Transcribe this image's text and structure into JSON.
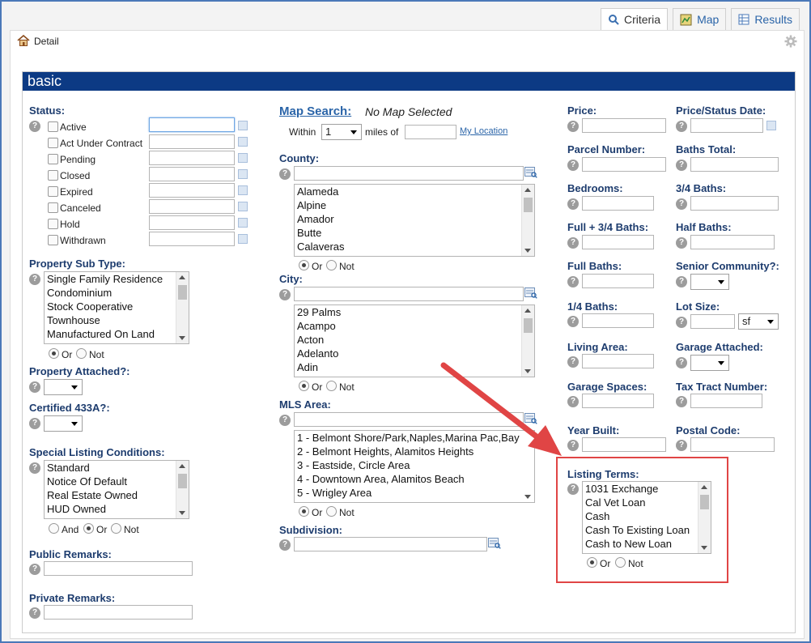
{
  "tabs": [
    {
      "label": "Criteria",
      "icon": "search-icon"
    },
    {
      "label": "Map",
      "icon": "map-icon"
    },
    {
      "label": "Results",
      "icon": "results-table-icon"
    }
  ],
  "detail": {
    "label": "Detail",
    "icon": "home-icon"
  },
  "section_title": "basic",
  "status": {
    "label": "Status:",
    "items": [
      "Active",
      "Act Under Contract",
      "Pending",
      "Closed",
      "Expired",
      "Canceled",
      "Hold",
      "Withdrawn"
    ]
  },
  "property_sub_type": {
    "label": "Property Sub Type:",
    "options": [
      "Single Family Residence",
      "Condominium",
      "Stock Cooperative",
      "Townhouse",
      "Manufactured On Land"
    ],
    "or": "Or",
    "not": "Not"
  },
  "property_attached": {
    "label": "Property Attached?:"
  },
  "certified_433a": {
    "label": "Certified 433A?:"
  },
  "special_listing": {
    "label": "Special Listing Conditions:",
    "options": [
      "Standard",
      "Notice Of Default",
      "Real Estate Owned",
      "HUD Owned"
    ],
    "and": "And",
    "or": "Or",
    "not": "Not"
  },
  "public_remarks": {
    "label": "Public Remarks:"
  },
  "private_remarks": {
    "label": "Private Remarks:"
  },
  "map_search": {
    "link": "Map Search:",
    "status": "No Map Selected",
    "within": "Within",
    "within_value": "1",
    "miles_of": "miles of",
    "my_location": "My Location"
  },
  "county": {
    "label": "County:",
    "options": [
      "Alameda",
      "Alpine",
      "Amador",
      "Butte",
      "Calaveras"
    ],
    "or": "Or",
    "not": "Not"
  },
  "city": {
    "label": "City:",
    "options": [
      "29 Palms",
      "Acampo",
      "Acton",
      "Adelanto",
      "Adin"
    ],
    "or": "Or",
    "not": "Not"
  },
  "mls_area": {
    "label": "MLS Area:",
    "options": [
      "1 - Belmont Shore/Park,Naples,Marina Pac,Bay",
      "2 - Belmont Heights, Alamitos Heights",
      "3 - Eastside, Circle Area",
      "4 - Downtown Area, Alamitos Beach",
      "5 - Wrigley Area"
    ],
    "or": "Or",
    "not": "Not"
  },
  "subdivision": {
    "label": "Subdivision:"
  },
  "fields": {
    "price": "Price:",
    "price_status_date": "Price/Status Date:",
    "parcel_number": "Parcel Number:",
    "baths_total": "Baths Total:",
    "bedrooms": "Bedrooms:",
    "three_quarter_baths": "3/4 Baths:",
    "full_three_quarter_baths": "Full + 3/4 Baths:",
    "half_baths": "Half Baths:",
    "full_baths": "Full Baths:",
    "senior_community": "Senior Community?:",
    "quarter_baths": "1/4 Baths:",
    "lot_size": "Lot Size:",
    "lot_unit": "sf",
    "living_area": "Living Area:",
    "garage_attached": "Garage Attached:",
    "garage_spaces": "Garage Spaces:",
    "tax_tract_number": "Tax Tract Number:",
    "year_built": "Year Built:",
    "postal_code": "Postal Code:"
  },
  "listing_terms": {
    "label": "Listing Terms:",
    "options": [
      "1031 Exchange",
      "Cal Vet Loan",
      "Cash",
      "Cash To Existing Loan",
      "Cash to New Loan"
    ],
    "or": "Or",
    "not": "Not"
  },
  "help_glyph": "?",
  "colors": {
    "section_header": "#0c3a84",
    "label": "#1d3c6e",
    "link": "#2a64a8",
    "highlight": "#e04545",
    "arrow": "#e04545"
  }
}
